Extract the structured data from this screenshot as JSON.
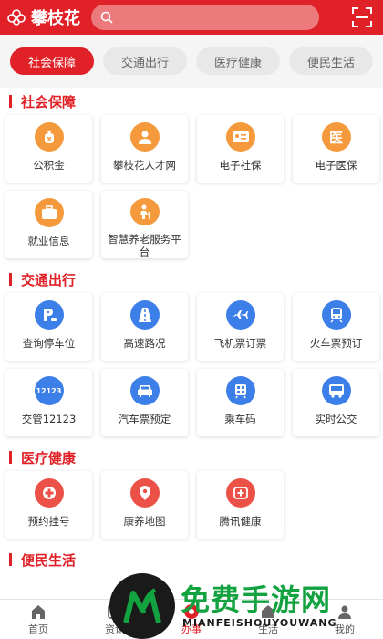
{
  "header": {
    "app_name": "攀枝花",
    "search_placeholder": ""
  },
  "tabs": [
    {
      "label": "社会保障"
    },
    {
      "label": "交通出行"
    },
    {
      "label": "医疗健康"
    },
    {
      "label": "便民生活"
    }
  ],
  "sections": [
    {
      "title": "社会保障",
      "items": [
        {
          "label": "公积金",
          "icon": "money-bag-icon"
        },
        {
          "label": "攀枝花人才网",
          "icon": "person-icon"
        },
        {
          "label": "电子社保",
          "icon": "id-card-icon"
        },
        {
          "label": "电子医保",
          "icon": "medical-badge-icon",
          "glyph": "医"
        },
        {
          "label": "就业信息",
          "icon": "briefcase-icon"
        },
        {
          "label": "智慧养老服务平台",
          "icon": "elderly-icon"
        }
      ]
    },
    {
      "title": "交通出行",
      "items": [
        {
          "label": "查询停车位",
          "icon": "parking-icon"
        },
        {
          "label": "高速路况",
          "icon": "road-icon"
        },
        {
          "label": "飞机票订票",
          "icon": "airplane-icon"
        },
        {
          "label": "火车票预订",
          "icon": "train-icon"
        },
        {
          "label": "交管12123",
          "icon": "traffic-12123-icon",
          "glyph": "12123"
        },
        {
          "label": "汽车票预定",
          "icon": "car-icon"
        },
        {
          "label": "乘车码",
          "icon": "bus-code-icon"
        },
        {
          "label": "实时公交",
          "icon": "bus-icon"
        }
      ]
    },
    {
      "title": "医疗健康",
      "items": [
        {
          "label": "预约挂号",
          "icon": "medical-cross-icon"
        },
        {
          "label": "康养地图",
          "icon": "map-pin-icon"
        },
        {
          "label": "腾讯健康",
          "icon": "health-plus-icon"
        }
      ]
    },
    {
      "title": "便民生活",
      "items": []
    }
  ],
  "bottom_nav": [
    {
      "label": "首页",
      "icon": "home-icon"
    },
    {
      "label": "资讯",
      "icon": "news-icon"
    },
    {
      "label": "办事",
      "icon": "service-icon"
    },
    {
      "label": "生活",
      "icon": "life-icon"
    },
    {
      "label": "我的",
      "icon": "user-icon"
    }
  ],
  "watermark": {
    "title": "免费手游网",
    "subtitle": "MIANFEISHOUYOUWANG"
  },
  "colors": {
    "brand": "#e02228",
    "orange": "#f59a3c",
    "blue": "#3d7fe8",
    "red": "#ec5148"
  }
}
